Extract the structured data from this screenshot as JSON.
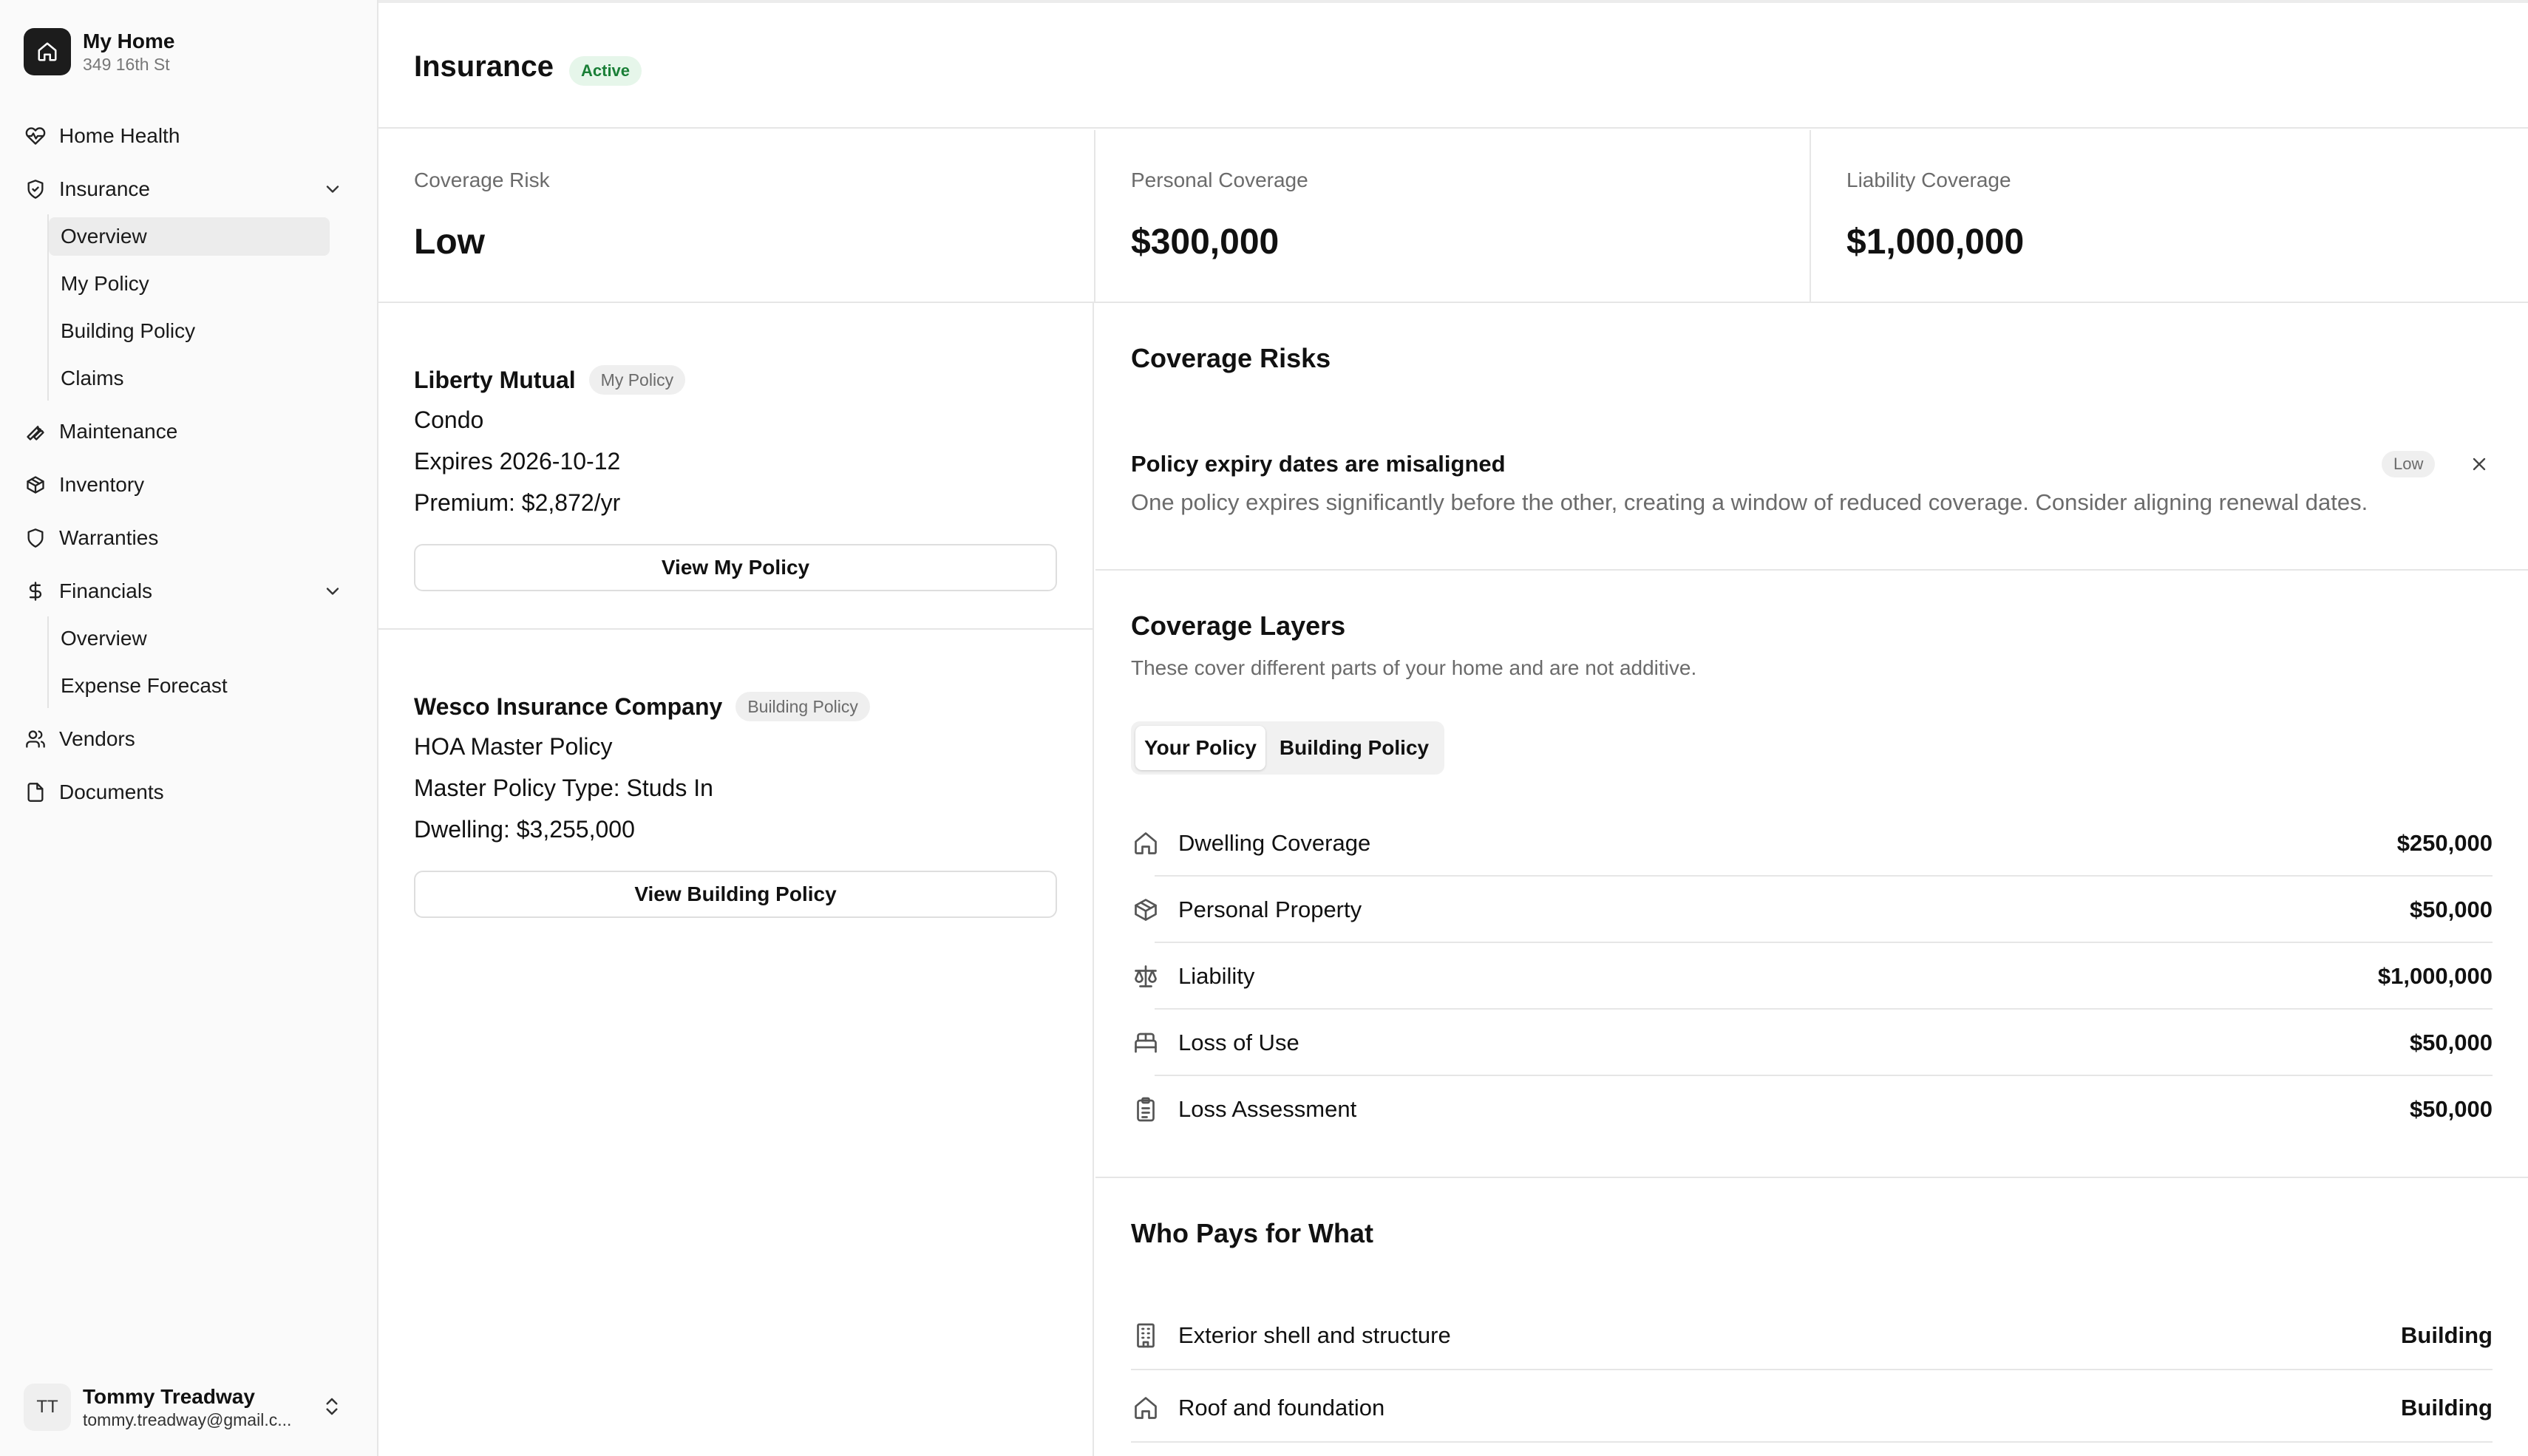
{
  "sidebar": {
    "brand": {
      "title": "My Home",
      "subtitle": "349 16th St",
      "icon": "home-icon"
    },
    "nav": {
      "home_health": "Home Health",
      "insurance": "Insurance",
      "insurance_sub": [
        "Overview",
        "My Policy",
        "Building Policy",
        "Claims"
      ],
      "maintenance": "Maintenance",
      "inventory": "Inventory",
      "warranties": "Warranties",
      "financials": "Financials",
      "financials_sub": [
        "Overview",
        "Expense Forecast"
      ],
      "vendors": "Vendors",
      "documents": "Documents"
    },
    "active_item": "Overview",
    "user": {
      "initials": "TT",
      "name": "Tommy Treadway",
      "email": "tommy.treadway@gmail.c..."
    }
  },
  "header": {
    "title": "Insurance",
    "status": "Active"
  },
  "stats": [
    {
      "label": "Coverage Risk",
      "value": "Low"
    },
    {
      "label": "Personal Coverage",
      "value": "$300,000"
    },
    {
      "label": "Liability Coverage",
      "value": "$1,000,000"
    }
  ],
  "policies": [
    {
      "carrier": "Liberty Mutual",
      "tag": "My Policy",
      "lines": [
        "Condo",
        "Expires 2026-10-12",
        "Premium: $2,872/yr"
      ],
      "button": "View My Policy"
    },
    {
      "carrier": "Wesco Insurance Company",
      "tag": "Building Policy",
      "lines": [
        "HOA Master Policy",
        "Master Policy Type: Studs In",
        "Dwelling: $3,255,000"
      ],
      "button": "View Building Policy"
    }
  ],
  "coverage_risks": {
    "title": "Coverage Risks",
    "items": [
      {
        "title": "Policy expiry dates are misaligned",
        "severity": "Low",
        "description": "One policy expires significantly before the other, creating a window of reduced coverage. Consider aligning renewal dates."
      }
    ]
  },
  "coverage_layers": {
    "title": "Coverage Layers",
    "subtitle": "These cover different parts of your home and are not additive.",
    "tabs": [
      "Your Policy",
      "Building Policy"
    ],
    "selected_tab": "Your Policy",
    "rows": [
      {
        "label": "Dwelling Coverage",
        "value": "$250,000",
        "icon": "home-icon"
      },
      {
        "label": "Personal Property",
        "value": "$50,000",
        "icon": "package-icon"
      },
      {
        "label": "Liability",
        "value": "$1,000,000",
        "icon": "scale-icon"
      },
      {
        "label": "Loss of Use",
        "value": "$50,000",
        "icon": "bed-icon"
      },
      {
        "label": "Loss Assessment",
        "value": "$50,000",
        "icon": "clipboard-icon"
      }
    ]
  },
  "who_pays": {
    "title": "Who Pays for What",
    "rows": [
      {
        "label": "Exterior shell and structure",
        "value": "Building",
        "icon": "building-icon"
      },
      {
        "label": "Roof and foundation",
        "value": "Building",
        "icon": "home-icon"
      }
    ]
  },
  "colors": {
    "active_badge_bg": "#e6f6ea",
    "active_badge_text": "#1a7f37",
    "brand": "#1c1c1c"
  }
}
